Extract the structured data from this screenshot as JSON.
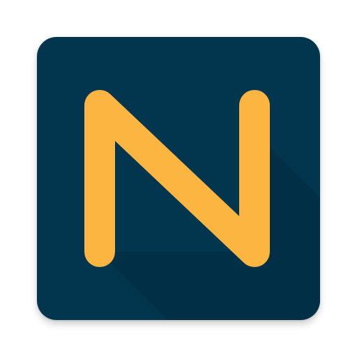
{
  "icon": {
    "name": "n-logo-icon",
    "letter": "N",
    "colors": {
      "background": "#02364F",
      "letter": "#FBB540",
      "shadow": "#012A3E"
    }
  }
}
